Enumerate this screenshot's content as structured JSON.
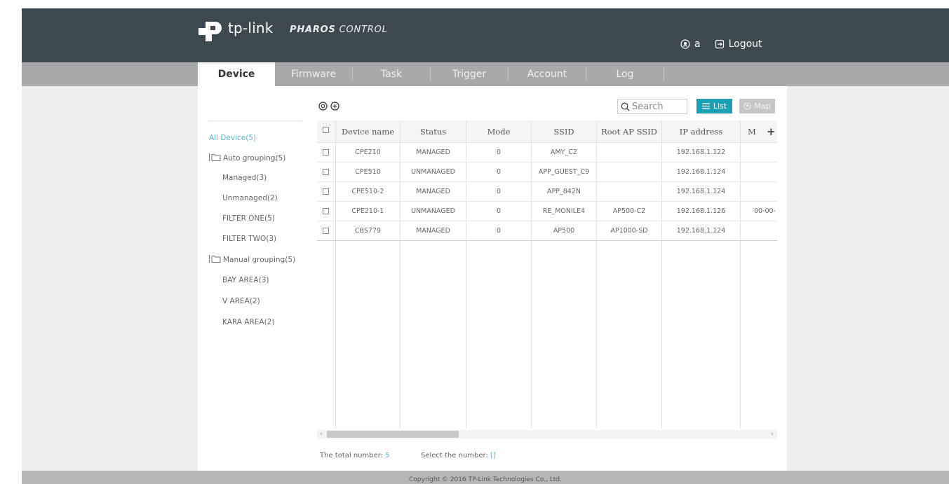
{
  "header": {
    "brand": "tp-link",
    "product_bold": "PHAROS",
    "product_light": " CONTROL",
    "user": "a",
    "logout": "Logout"
  },
  "tabs": [
    {
      "label": "Device",
      "active": true
    },
    {
      "label": "Firmware",
      "active": false
    },
    {
      "label": "Task",
      "active": false
    },
    {
      "label": "Trigger",
      "active": false
    },
    {
      "label": "Account",
      "active": false
    },
    {
      "label": "Log",
      "active": false
    }
  ],
  "sidebar": {
    "items": [
      {
        "label": "All Device(5)",
        "selected": true,
        "folder": false
      },
      {
        "label": "Auto grouping(5)",
        "selected": false,
        "folder": true
      },
      {
        "label": "Managed(3)",
        "selected": false,
        "folder": false
      },
      {
        "label": "Unmanaged(2)",
        "selected": false,
        "folder": false
      },
      {
        "label": "FILTER ONE(5)",
        "selected": false,
        "folder": false
      },
      {
        "label": "FILTER TWO(3)",
        "selected": false,
        "folder": false
      },
      {
        "label": "Manual grouping(5)",
        "selected": false,
        "folder": true
      },
      {
        "label": "BAY AREA(3)",
        "selected": false,
        "folder": false
      },
      {
        "label": "V AREA(2)",
        "selected": false,
        "folder": false
      },
      {
        "label": "KARA AREA(2)",
        "selected": false,
        "folder": false
      }
    ]
  },
  "toolbar": {
    "search_placeholder": "Search",
    "list_label": "List",
    "map_label": "Map"
  },
  "table": {
    "columns": [
      "Device name",
      "Status",
      "Mode",
      "SSID",
      "Root AP SSID",
      "IP address",
      "M"
    ],
    "rows": [
      [
        "CPE210",
        "MANAGED",
        "0",
        "AMY_C2",
        "",
        "192.168.1.122",
        ""
      ],
      [
        "CPE510",
        "UNMANAGED",
        "0",
        "APP_GUEST_C9",
        "",
        "192.168.1.124",
        ""
      ],
      [
        "CPE510-2",
        "MANAGED",
        "0",
        "APP_842N",
        "",
        "192.168.1.124",
        ""
      ],
      [
        "CPE210-1",
        "UNMANAGED",
        "0",
        "RE_MONILE4",
        "AP500-C2",
        "192.168.1.126",
        "00-00-"
      ],
      [
        "CBS779",
        "MANAGED",
        "0",
        "AP500",
        "AP1000-SD",
        "192.168.1.124",
        ""
      ]
    ]
  },
  "stats": {
    "total_label": "The total number:",
    "total_value": "5",
    "select_label": "Select the number:",
    "select_value": "[]"
  },
  "footer": {
    "copyright": "Copyright © 2016 TP-Link Technologies Co., Ltd."
  },
  "colors": {
    "header_bg": "#3c4a50",
    "accent": "#1e9fb4",
    "link": "#5bb5cc"
  }
}
